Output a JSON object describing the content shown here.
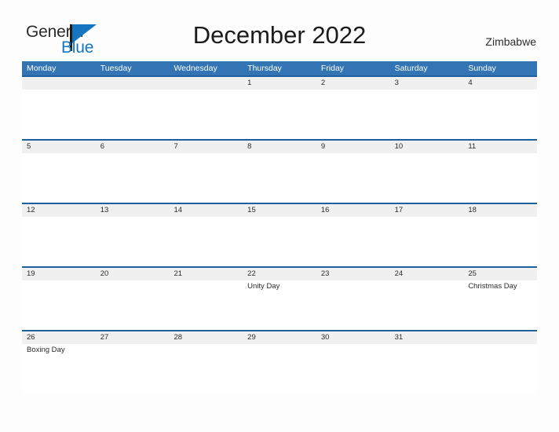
{
  "brand": {
    "name_part1": "General",
    "name_part2": "Blue",
    "flag_icon": "flag-triangle-icon"
  },
  "header": {
    "title": "December 2022",
    "country": "Zimbabwe"
  },
  "calendar": {
    "weekdays": [
      "Monday",
      "Tuesday",
      "Wednesday",
      "Thursday",
      "Friday",
      "Saturday",
      "Sunday"
    ],
    "accent_header_color": "#3274b4",
    "row_border_color": "#1f5f9e",
    "date_band_color": "#f0f0f0",
    "weeks": [
      {
        "dates": [
          "",
          "",
          "",
          "1",
          "2",
          "3",
          "4"
        ],
        "events": [
          "",
          "",
          "",
          "",
          "",
          "",
          ""
        ]
      },
      {
        "dates": [
          "5",
          "6",
          "7",
          "8",
          "9",
          "10",
          "11"
        ],
        "events": [
          "",
          "",
          "",
          "",
          "",
          "",
          ""
        ]
      },
      {
        "dates": [
          "12",
          "13",
          "14",
          "15",
          "16",
          "17",
          "18"
        ],
        "events": [
          "",
          "",
          "",
          "",
          "",
          "",
          ""
        ]
      },
      {
        "dates": [
          "19",
          "20",
          "21",
          "22",
          "23",
          "24",
          "25"
        ],
        "events": [
          "",
          "",
          "",
          "Unity Day",
          "",
          "",
          "Christmas Day"
        ]
      },
      {
        "dates": [
          "26",
          "27",
          "28",
          "29",
          "30",
          "31",
          ""
        ],
        "events": [
          "Boxing Day",
          "",
          "",
          "",
          "",
          "",
          ""
        ]
      }
    ]
  }
}
